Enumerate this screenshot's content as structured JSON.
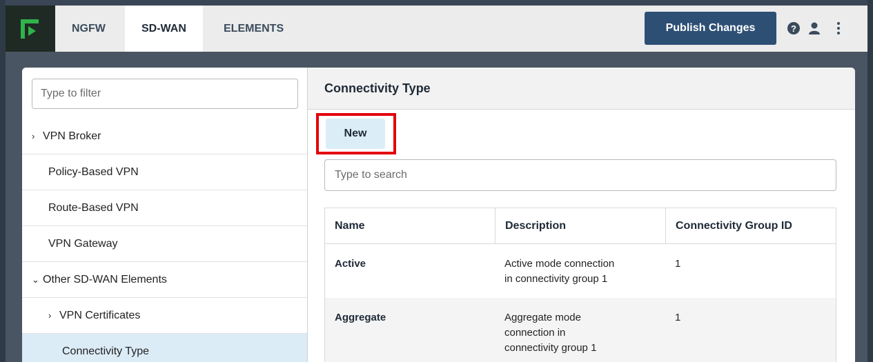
{
  "brand": {
    "accent": "#2d4f74",
    "logo_green": "#2fb34a",
    "highlight": "#e3000b"
  },
  "nav": {
    "tabs": [
      {
        "label": "NGFW",
        "active": false
      },
      {
        "label": "SD-WAN",
        "active": true
      },
      {
        "label": "ELEMENTS",
        "active": false
      }
    ],
    "publish_label": "Publish Changes",
    "icons": [
      "help-icon",
      "user-icon",
      "more-vertical-icon"
    ]
  },
  "sidebar": {
    "filter_placeholder": "Type to filter",
    "items": [
      {
        "label": "VPN Broker",
        "chevron": "›",
        "indent": 0
      },
      {
        "label": "Policy-Based VPN",
        "chevron": "",
        "indent": 1
      },
      {
        "label": "Route-Based VPN",
        "chevron": "",
        "indent": 1
      },
      {
        "label": "VPN Gateway",
        "chevron": "",
        "indent": 0
      },
      {
        "label": "Other SD-WAN Elements",
        "chevron": "⌄",
        "indent": 0
      },
      {
        "label": "VPN Certificates",
        "chevron": "›",
        "indent": 1
      },
      {
        "label": "Connectivity Type",
        "chevron": "",
        "indent": 2,
        "selected": true
      }
    ]
  },
  "main": {
    "title": "Connectivity Type",
    "new_label": "New",
    "search_placeholder": "Type to search",
    "table": {
      "headers": [
        "Name",
        "Description",
        "Connectivity Group ID"
      ],
      "rows": [
        {
          "name": "Active",
          "description_lines": [
            "Active mode connection",
            "in connectivity group 1"
          ],
          "group_id": "1"
        },
        {
          "name": "Aggregate",
          "description_lines": [
            "Aggregate mode",
            "connection in",
            "connectivity group 1"
          ],
          "group_id": "1"
        }
      ]
    }
  }
}
